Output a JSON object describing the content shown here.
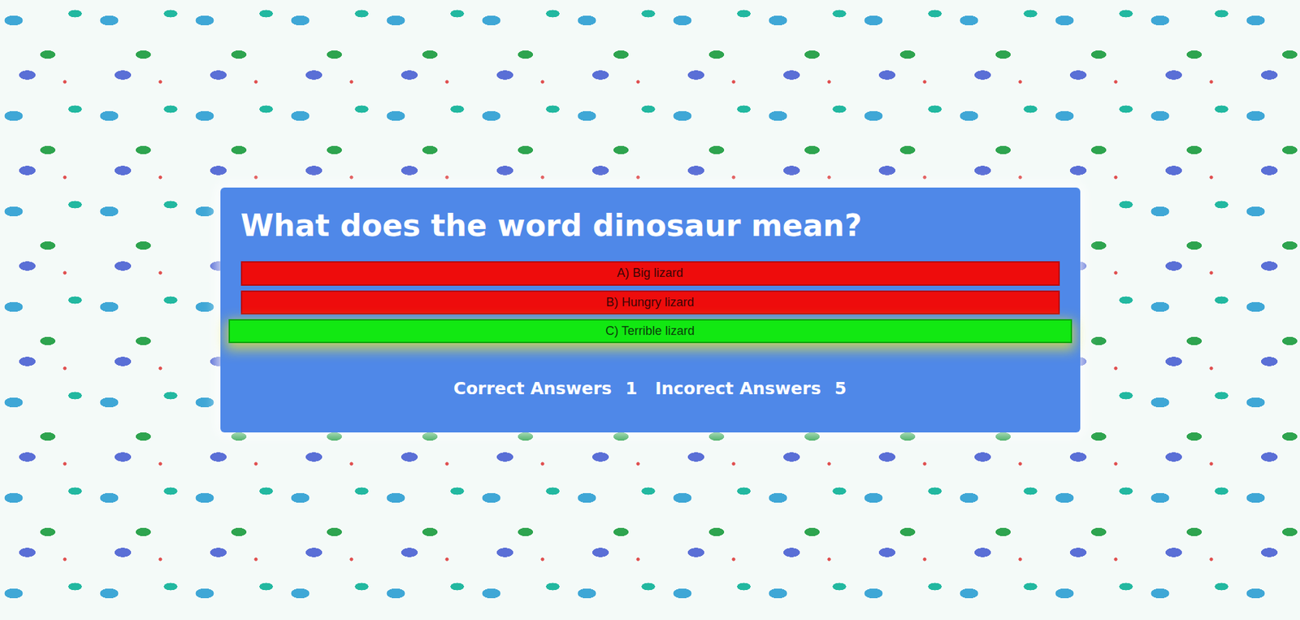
{
  "question": "What does the word dinosaur mean?",
  "answers": [
    {
      "label": "A) Big lizard",
      "correct": false,
      "selected": false
    },
    {
      "label": "B) Hungry lizard",
      "correct": false,
      "selected": false
    },
    {
      "label": "C) Terrible lizard",
      "correct": true,
      "selected": true
    }
  ],
  "score": {
    "correct_label": "Correct Answers",
    "correct": "1",
    "incorrect_label": "Incorect Answers",
    "incorrect": "5"
  }
}
